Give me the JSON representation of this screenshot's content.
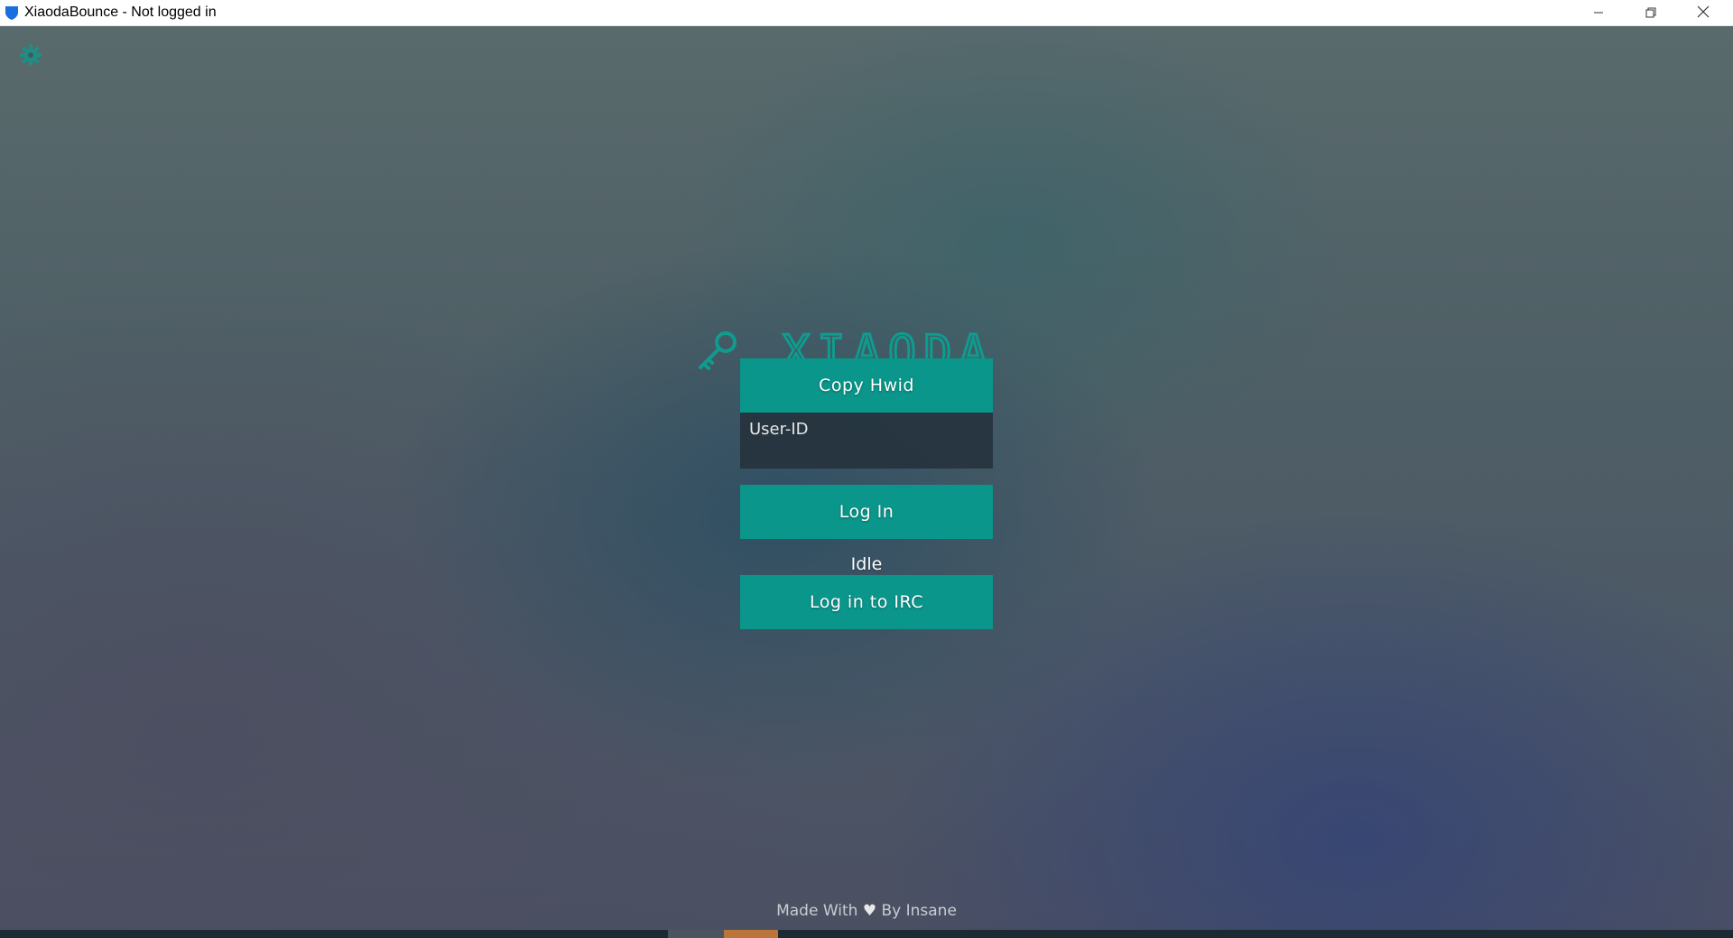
{
  "window": {
    "title": "XiaodaBounce - Not logged in"
  },
  "titlebar_icons": {
    "app": "shield-icon",
    "minimize": "minimize-icon",
    "restore": "restore-icon",
    "close": "close-icon"
  },
  "login": {
    "logo_icon": "key-icon",
    "logo_text": "XIAODA",
    "copy_hwid_label": "Copy Hwid",
    "userid_placeholder": "User-ID",
    "userid_value": "",
    "login_label": "Log In",
    "status": "Idle",
    "irc_label": "Log in to IRC"
  },
  "settings_icon": "gear-icon",
  "footer": {
    "prefix": "Made With",
    "heart_icon": "heart-icon",
    "suffix": "By Insane"
  },
  "colors": {
    "accent": "#0a968a",
    "logo": "#0e9c8e",
    "input_bg": "#23303a",
    "footer_text": "#c9ccd2"
  }
}
